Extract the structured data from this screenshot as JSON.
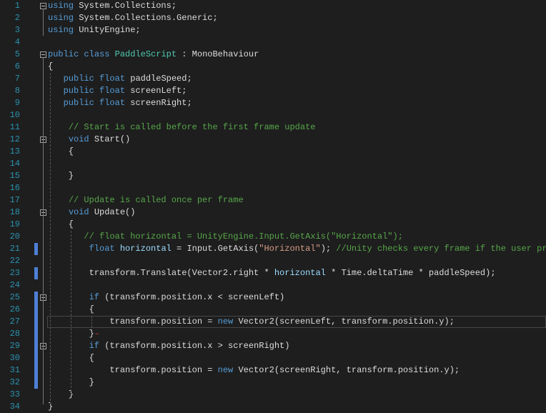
{
  "editor": {
    "lines": [
      {
        "n": "1",
        "fold": true,
        "t": [
          [
            "kw",
            "using"
          ],
          [
            "pl",
            " System.Collections;"
          ]
        ]
      },
      {
        "n": "2",
        "t": [
          [
            "kw",
            "using"
          ],
          [
            "pl",
            " System.Collections.Generic;"
          ]
        ]
      },
      {
        "n": "3",
        "t": [
          [
            "kw",
            "using"
          ],
          [
            "pl",
            " UnityEngine;"
          ]
        ]
      },
      {
        "n": "4",
        "t": []
      },
      {
        "n": "5",
        "fold": true,
        "t": [
          [
            "kw",
            "public"
          ],
          [
            "pl",
            " "
          ],
          [
            "kw",
            "class"
          ],
          [
            "pl",
            " "
          ],
          [
            "ty",
            "PaddleScript"
          ],
          [
            "pl",
            " : MonoBehaviour"
          ]
        ]
      },
      {
        "n": "6",
        "t": [
          [
            "pl",
            "{"
          ]
        ]
      },
      {
        "n": "7",
        "t": [
          [
            "pl",
            "   "
          ],
          [
            "kw",
            "public"
          ],
          [
            "pl",
            " "
          ],
          [
            "kw",
            "float"
          ],
          [
            "pl",
            " paddleSpeed;"
          ]
        ]
      },
      {
        "n": "8",
        "t": [
          [
            "pl",
            "   "
          ],
          [
            "kw",
            "public"
          ],
          [
            "pl",
            " "
          ],
          [
            "kw",
            "float"
          ],
          [
            "pl",
            " screenLeft;"
          ]
        ]
      },
      {
        "n": "9",
        "t": [
          [
            "pl",
            "   "
          ],
          [
            "kw",
            "public"
          ],
          [
            "pl",
            " "
          ],
          [
            "kw",
            "float"
          ],
          [
            "pl",
            " screenRight;"
          ]
        ]
      },
      {
        "n": "10",
        "t": []
      },
      {
        "n": "11",
        "t": [
          [
            "pl",
            "    "
          ],
          [
            "cm",
            "// Start is called before the first frame update"
          ]
        ]
      },
      {
        "n": "12",
        "fold": true,
        "t": [
          [
            "pl",
            "    "
          ],
          [
            "kw",
            "void"
          ],
          [
            "pl",
            " Start()"
          ]
        ]
      },
      {
        "n": "13",
        "t": [
          [
            "pl",
            "    {"
          ]
        ]
      },
      {
        "n": "14",
        "t": []
      },
      {
        "n": "15",
        "t": [
          [
            "pl",
            "    }"
          ]
        ]
      },
      {
        "n": "16",
        "t": []
      },
      {
        "n": "17",
        "t": [
          [
            "pl",
            "    "
          ],
          [
            "cm",
            "// Update is called once per frame"
          ]
        ]
      },
      {
        "n": "18",
        "fold": true,
        "t": [
          [
            "pl",
            "    "
          ],
          [
            "kw",
            "void"
          ],
          [
            "pl",
            " Update()"
          ]
        ]
      },
      {
        "n": "19",
        "t": [
          [
            "pl",
            "    {"
          ]
        ]
      },
      {
        "n": "20",
        "t": [
          [
            "pl",
            "       "
          ],
          [
            "cm",
            "// float horizontal = UnityEngine.Input.GetAxis(\"Horizontal\");"
          ]
        ]
      },
      {
        "n": "21",
        "chg": true,
        "t": [
          [
            "pl",
            "        "
          ],
          [
            "kw",
            "float"
          ],
          [
            "pl",
            " "
          ],
          [
            "var",
            "horizontal"
          ],
          [
            "pl",
            " = Input.GetAxis("
          ],
          [
            "st",
            "\"Horizontal\""
          ],
          [
            "pl",
            "); "
          ],
          [
            "cm",
            "//Unity checks every frame if the user presses"
          ]
        ]
      },
      {
        "n": "22",
        "t": []
      },
      {
        "n": "23",
        "chg": true,
        "t": [
          [
            "pl",
            "        transform.Translate(Vector2.right * "
          ],
          [
            "var",
            "horizontal"
          ],
          [
            "pl",
            " * Time.deltaTime * paddleSpeed);"
          ]
        ]
      },
      {
        "n": "24",
        "t": []
      },
      {
        "n": "25",
        "chg": true,
        "fold": true,
        "t": [
          [
            "pl",
            "        "
          ],
          [
            "kw",
            "if"
          ],
          [
            "pl",
            " (transform.position.x < screenLeft)"
          ]
        ]
      },
      {
        "n": "26",
        "chg": true,
        "t": [
          [
            "pl",
            "        {"
          ]
        ]
      },
      {
        "n": "27",
        "chg": true,
        "cur": true,
        "t": [
          [
            "pl",
            "            transform.position = "
          ],
          [
            "kw",
            "new"
          ],
          [
            "pl",
            " Vector2(screenLeft, transform.position.y);"
          ]
        ]
      },
      {
        "n": "28",
        "chg": true,
        "t": [
          [
            "pl",
            "        }"
          ]
        ]
      },
      {
        "n": "29",
        "chg": true,
        "fold": true,
        "t": [
          [
            "pl",
            "        "
          ],
          [
            "kw",
            "if"
          ],
          [
            "pl",
            " (transform.position.x > screenRight)"
          ]
        ]
      },
      {
        "n": "30",
        "chg": true,
        "t": [
          [
            "pl",
            "        {"
          ]
        ]
      },
      {
        "n": "31",
        "chg": true,
        "t": [
          [
            "pl",
            "            transform.position = "
          ],
          [
            "kw",
            "new"
          ],
          [
            "pl",
            " Vector2(screenRight, transform.position.y);"
          ]
        ]
      },
      {
        "n": "32",
        "chg": true,
        "t": [
          [
            "pl",
            "        }"
          ]
        ]
      },
      {
        "n": "33",
        "t": [
          [
            "pl",
            "    }"
          ]
        ]
      },
      {
        "n": "34",
        "t": [
          [
            "pl",
            "}"
          ]
        ]
      }
    ]
  }
}
